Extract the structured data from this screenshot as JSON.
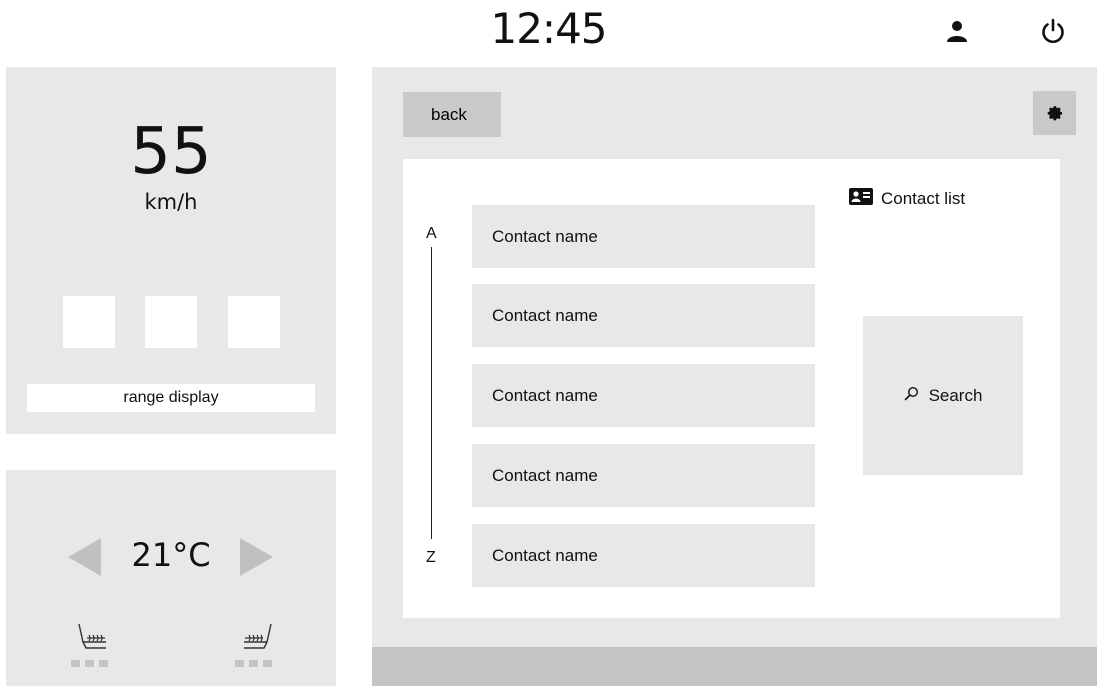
{
  "status_bar": {
    "clock": "12:45",
    "user_icon": "user-icon",
    "power_icon": "power-icon"
  },
  "dashboard": {
    "speed_value": "55",
    "speed_unit": "km/h",
    "range_label": "range display"
  },
  "climate": {
    "temperature": "21°C",
    "left_arrow_icon": "arrow-left-icon",
    "right_arrow_icon": "arrow-right-icon",
    "left_seat_icon": "seat-heater-left-icon",
    "right_seat_icon": "seat-heater-right-icon"
  },
  "contacts_screen": {
    "back_label": "back",
    "settings_icon": "gear-icon",
    "index_start": "A",
    "index_end": "Z",
    "contacts": [
      {
        "name": "Contact name"
      },
      {
        "name": "Contact name"
      },
      {
        "name": "Contact name"
      },
      {
        "name": "Contact name"
      },
      {
        "name": "Contact name"
      }
    ],
    "list_title": "Contact list",
    "list_icon": "contact-card-icon",
    "search_label": "Search",
    "search_icon": "search-icon"
  },
  "colors": {
    "panel_gray": "#e8e8e8",
    "button_gray": "#c9c9c9",
    "strip_gray": "#c4c4c4",
    "arrow_gray": "#c0c0c0"
  }
}
